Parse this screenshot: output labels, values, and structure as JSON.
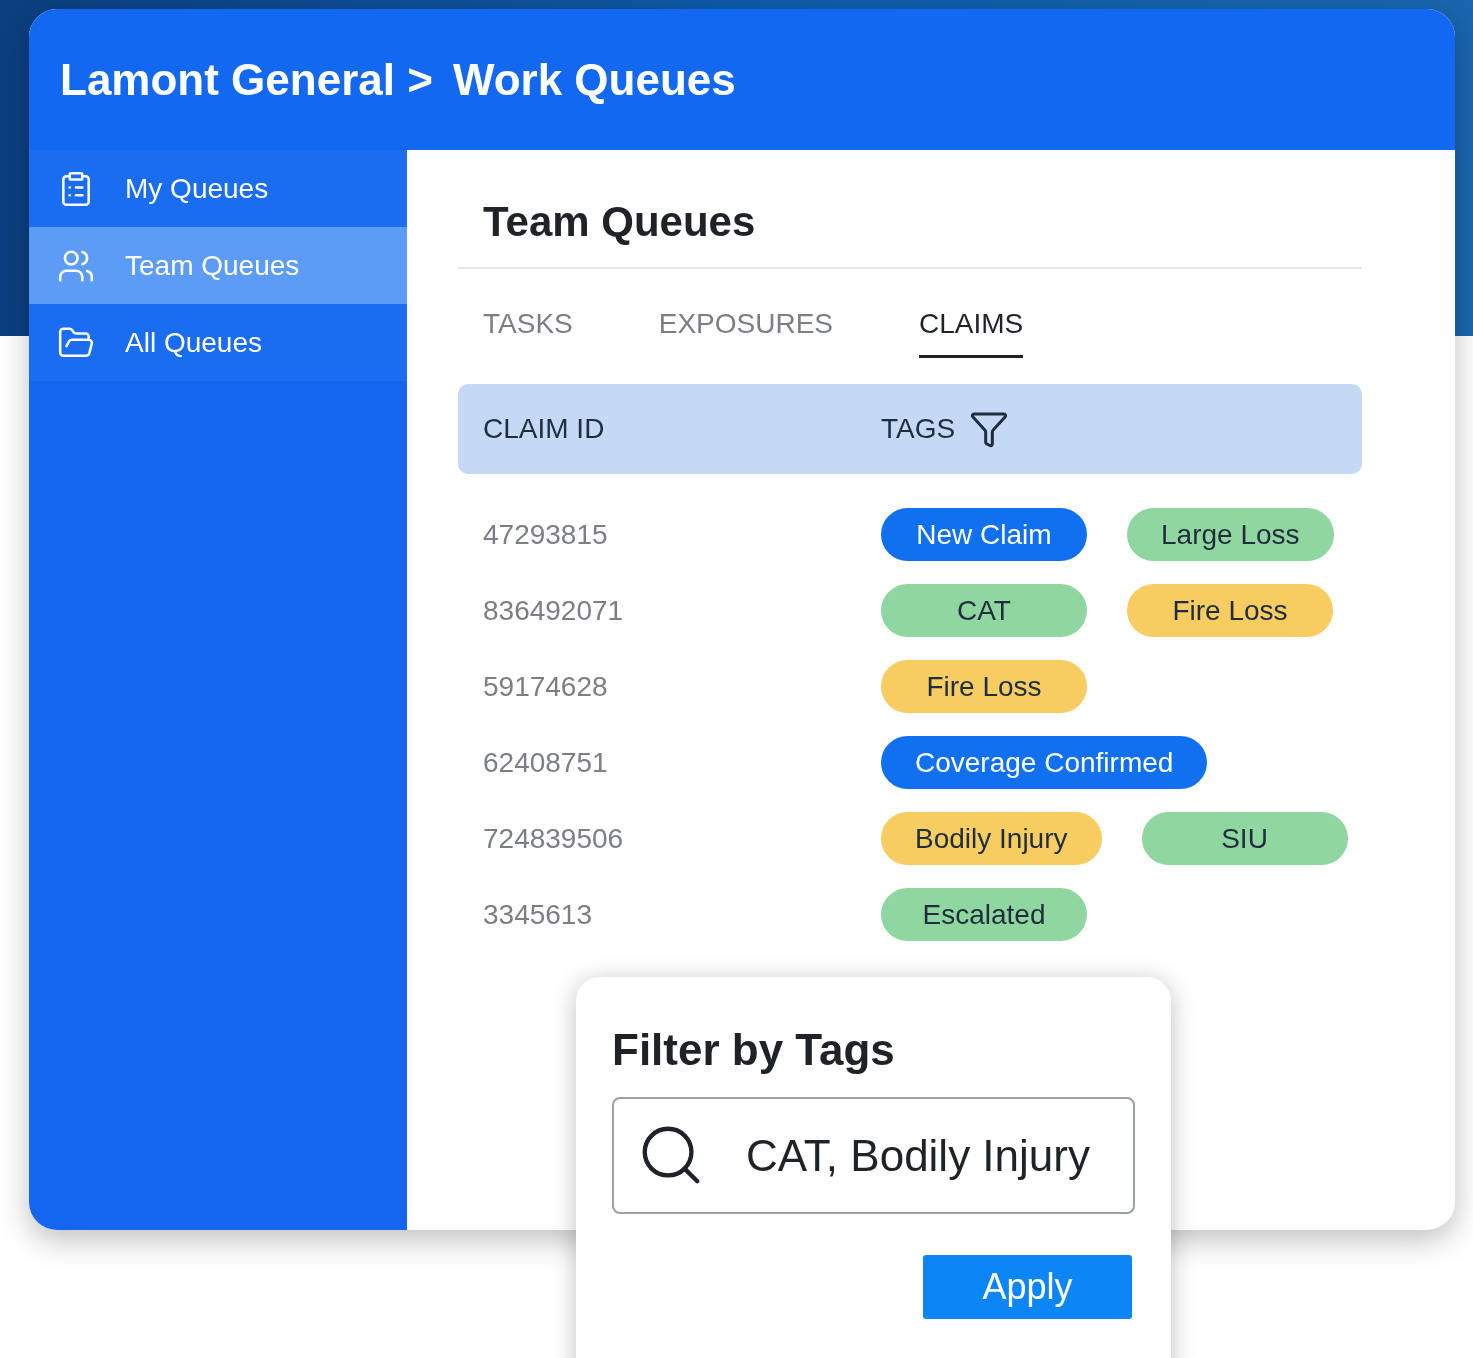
{
  "breadcrumb": {
    "parent": "Lamont General >",
    "current": "Work Queues"
  },
  "sidebar": {
    "items": [
      {
        "label": "My Queues",
        "selected": false
      },
      {
        "label": "Team Queues",
        "selected": true
      },
      {
        "label": "All Queues",
        "selected": false
      }
    ]
  },
  "page_title": "Team Queues",
  "tabs": [
    {
      "label": "TASKS",
      "selected": false
    },
    {
      "label": "EXPOSURES",
      "selected": false
    },
    {
      "label": "CLAIMS",
      "selected": true
    }
  ],
  "table": {
    "columns": [
      "CLAIM ID",
      "TAGS"
    ],
    "rows": [
      {
        "claim_id": "47293815",
        "tags": [
          {
            "label": "New Claim",
            "color": "#1170f0"
          },
          {
            "label": "Large Loss",
            "color": "#8fd6a0"
          }
        ]
      },
      {
        "claim_id": "836492071",
        "tags": [
          {
            "label": "CAT",
            "color": "#8fd6a0"
          },
          {
            "label": "Fire Loss",
            "color": "#f7cc60"
          }
        ]
      },
      {
        "claim_id": "59174628",
        "tags": [
          {
            "label": "Fire Loss",
            "color": "#f7cc60"
          }
        ]
      },
      {
        "claim_id": "62408751",
        "tags": [
          {
            "label": "Coverage Confirmed",
            "color": "#1170f0"
          }
        ]
      },
      {
        "claim_id": "724839506",
        "tags": [
          {
            "label": "Bodily Injury",
            "color": "#f7cc60"
          },
          {
            "label": "SIU",
            "color": "#8fd6a0"
          }
        ]
      },
      {
        "claim_id": "3345613",
        "tags": [
          {
            "label": "Escalated",
            "color": "#8fd6a0"
          }
        ]
      }
    ]
  },
  "filter_popup": {
    "title": "Filter by Tags",
    "search": {
      "value": "CAT, Bodily Injury"
    },
    "button": "Apply"
  }
}
